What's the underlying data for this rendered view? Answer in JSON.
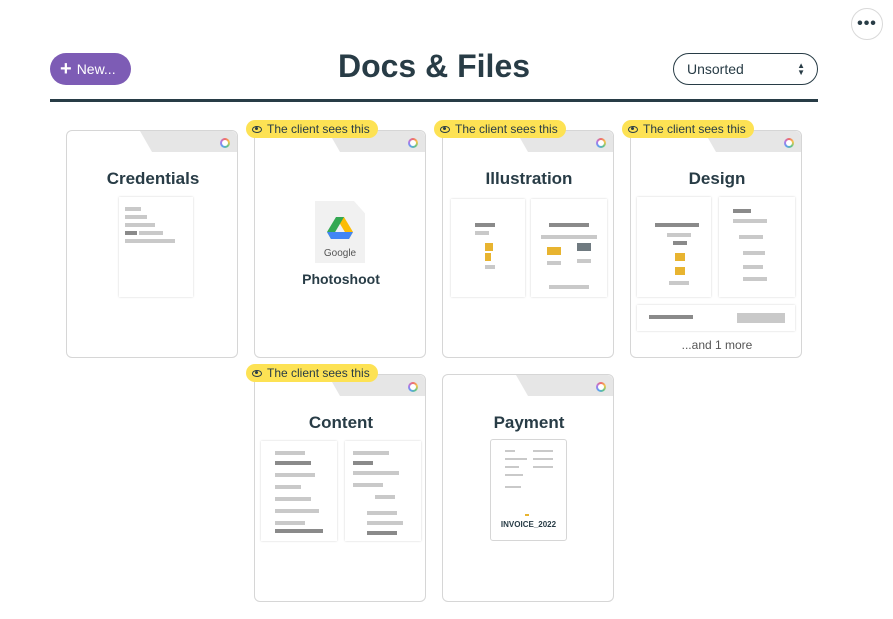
{
  "header": {
    "new_label": "New...",
    "title": "Docs & Files",
    "sort_value": "Unsorted",
    "more_label": "•••"
  },
  "folders": [
    {
      "name": "Credentials",
      "client_visible": false
    },
    {
      "name": "",
      "client_visible": true,
      "file_label": "Photoshoot",
      "file_type": "Google"
    },
    {
      "name": "Illustration",
      "client_visible": true
    },
    {
      "name": "Design",
      "client_visible": true,
      "more_text": "...and 1 more"
    },
    {
      "name": "Content",
      "client_visible": true
    },
    {
      "name": "Payment",
      "client_visible": false,
      "file_label": "INVOICE_2022"
    }
  ],
  "badge_text": "The client sees this",
  "colors": {
    "accent": "#7d5cb5",
    "badge": "#fde254",
    "text": "#283c46"
  }
}
